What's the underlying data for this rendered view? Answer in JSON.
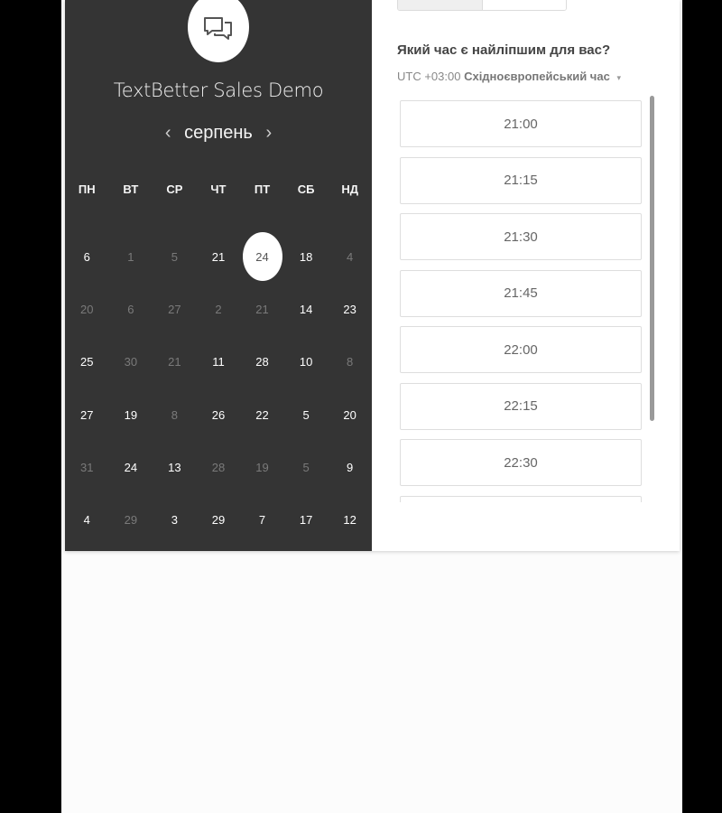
{
  "company_name": "TextBetter Sales Demo",
  "calendar": {
    "month": "серпень",
    "prev_arrow": "‹",
    "next_arrow": "›",
    "weekdays": [
      "ПН",
      "ВТ",
      "СР",
      "ЧТ",
      "ПТ",
      "СБ",
      "НД"
    ],
    "weeks": [
      [
        {
          "d": "6",
          "a": true
        },
        {
          "d": "1",
          "a": false
        },
        {
          "d": "5",
          "a": false
        },
        {
          "d": "21",
          "a": true
        },
        {
          "d": "24",
          "a": true,
          "sel": true
        },
        {
          "d": "18",
          "a": true
        },
        {
          "d": "4",
          "a": false
        }
      ],
      [
        {
          "d": "20",
          "a": false
        },
        {
          "d": "6",
          "a": false
        },
        {
          "d": "27",
          "a": false
        },
        {
          "d": "2",
          "a": false
        },
        {
          "d": "21",
          "a": false
        },
        {
          "d": "14",
          "a": true
        },
        {
          "d": "23",
          "a": true
        }
      ],
      [
        {
          "d": "25",
          "a": true
        },
        {
          "d": "30",
          "a": false
        },
        {
          "d": "21",
          "a": false
        },
        {
          "d": "11",
          "a": true
        },
        {
          "d": "28",
          "a": true
        },
        {
          "d": "10",
          "a": true
        },
        {
          "d": "8",
          "a": false
        }
      ],
      [
        {
          "d": "27",
          "a": true
        },
        {
          "d": "19",
          "a": true
        },
        {
          "d": "8",
          "a": false
        },
        {
          "d": "26",
          "a": true
        },
        {
          "d": "22",
          "a": true
        },
        {
          "d": "5",
          "a": true
        },
        {
          "d": "20",
          "a": true
        }
      ],
      [
        {
          "d": "31",
          "a": false
        },
        {
          "d": "24",
          "a": true
        },
        {
          "d": "13",
          "a": true
        },
        {
          "d": "28",
          "a": false
        },
        {
          "d": "19",
          "a": false
        },
        {
          "d": "5",
          "a": false
        },
        {
          "d": "9",
          "a": true
        }
      ],
      [
        {
          "d": "4",
          "a": true
        },
        {
          "d": "29",
          "a": false
        },
        {
          "d": "3",
          "a": true
        },
        {
          "d": "29",
          "a": true
        },
        {
          "d": "7",
          "a": true
        },
        {
          "d": "17",
          "a": true
        },
        {
          "d": "12",
          "a": true
        }
      ]
    ]
  },
  "question": "Який час є найліпшим для вас?",
  "timezone": {
    "prefix": "UTC +03:00",
    "name": "Східноєвропейський час",
    "caret": "▾"
  },
  "time_slots": [
    "21:00",
    "21:15",
    "21:30",
    "21:45",
    "22:00",
    "22:15",
    "22:30",
    ""
  ],
  "colors": {
    "calendar_bg": "#343434",
    "page_bg": "#fcfcfc",
    "selected_day_bg": "#ffffff"
  },
  "icons": {
    "logo": "chat-bubbles-icon",
    "timezone_caret": "caret-down-icon"
  }
}
